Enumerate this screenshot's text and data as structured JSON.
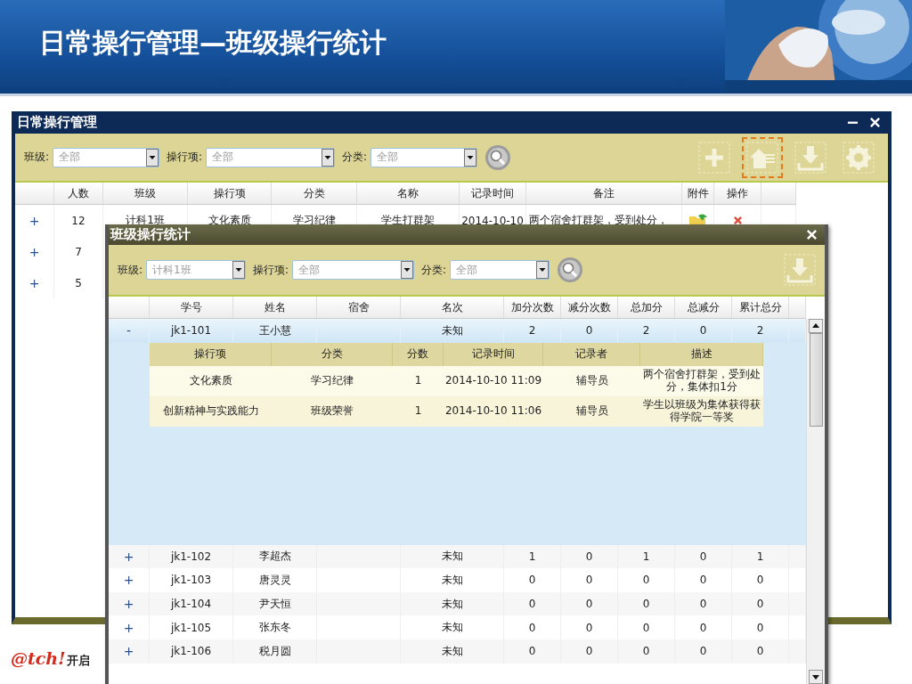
{
  "slide": {
    "title": "日常操行管理—班级操行统计",
    "logo": "@tch!",
    "logo_caption": "开启"
  },
  "main_window": {
    "title": "日常操行管理",
    "filters": [
      {
        "label": "班级:",
        "value": "全部"
      },
      {
        "label": "操行项:",
        "value": "全部"
      },
      {
        "label": "分类:",
        "value": "全部"
      }
    ],
    "toolbar_buttons": [
      {
        "kind": "add",
        "highlighted": false
      },
      {
        "kind": "home-list",
        "highlighted": true
      },
      {
        "kind": "download",
        "highlighted": false
      },
      {
        "kind": "settings",
        "highlighted": false
      }
    ],
    "table": {
      "columns": [
        "人数",
        "班级",
        "操行项",
        "分类",
        "名称",
        "记录时间",
        "备注",
        "附件",
        "操作"
      ],
      "rows": [
        {
          "expander": "+",
          "cells": [
            "12",
            "计科1班",
            "文化素质",
            "学习纪律",
            "学生打群架",
            "2014-10-10",
            "两个宿舍打群架，受到处分，"
          ],
          "attachment": true,
          "delete": true
        },
        {
          "expander": "+",
          "cells": [
            "7"
          ]
        },
        {
          "expander": "+",
          "cells": [
            "5"
          ]
        }
      ]
    }
  },
  "stats_window": {
    "title": "班级操行统计",
    "filters": [
      {
        "label": "班级:",
        "value": "计科1班"
      },
      {
        "label": "操行项:",
        "value": "全部"
      },
      {
        "label": "分类:",
        "value": "全部"
      }
    ],
    "table": {
      "columns": [
        "学号",
        "姓名",
        "宿舍",
        "名次",
        "加分次数",
        "减分次数",
        "总加分",
        "总减分",
        "累计总分"
      ],
      "rows": [
        {
          "expander": "-",
          "selected": true,
          "cells": [
            "jk1-101",
            "王小慧",
            "",
            "未知",
            "2",
            "0",
            "2",
            "0",
            "2"
          ],
          "details": {
            "columns": [
              "操行项",
              "分类",
              "分数",
              "记录时间",
              "记录者",
              "描述"
            ],
            "rows": [
              [
                "文化素质",
                "学习纪律",
                "1",
                "2014-10-10 11:09",
                "辅导员",
                "两个宿舍打群架，受到处分，集体扣1分"
              ],
              [
                "创新精神与实践能力",
                "班级荣誉",
                "1",
                "2014-10-10 11:06",
                "辅导员",
                "学生以班级为集体获得获得学院一等奖"
              ]
            ]
          }
        },
        {
          "expander": "+",
          "selected": false,
          "cells": [
            "jk1-102",
            "李超杰",
            "",
            "未知",
            "1",
            "0",
            "1",
            "0",
            "1"
          ]
        },
        {
          "expander": "+",
          "selected": false,
          "cells": [
            "jk1-103",
            "唐灵灵",
            "",
            "未知",
            "0",
            "0",
            "0",
            "0",
            "0"
          ]
        },
        {
          "expander": "+",
          "selected": false,
          "cells": [
            "jk1-104",
            "尹天恒",
            "",
            "未知",
            "0",
            "0",
            "0",
            "0",
            "0"
          ]
        },
        {
          "expander": "+",
          "selected": false,
          "cells": [
            "jk1-105",
            "张东冬",
            "",
            "未知",
            "0",
            "0",
            "0",
            "0",
            "0"
          ]
        },
        {
          "expander": "+",
          "selected": false,
          "cells": [
            "jk1-106",
            "税月圆",
            "",
            "未知",
            "0",
            "0",
            "0",
            "0",
            "0"
          ]
        }
      ]
    }
  }
}
